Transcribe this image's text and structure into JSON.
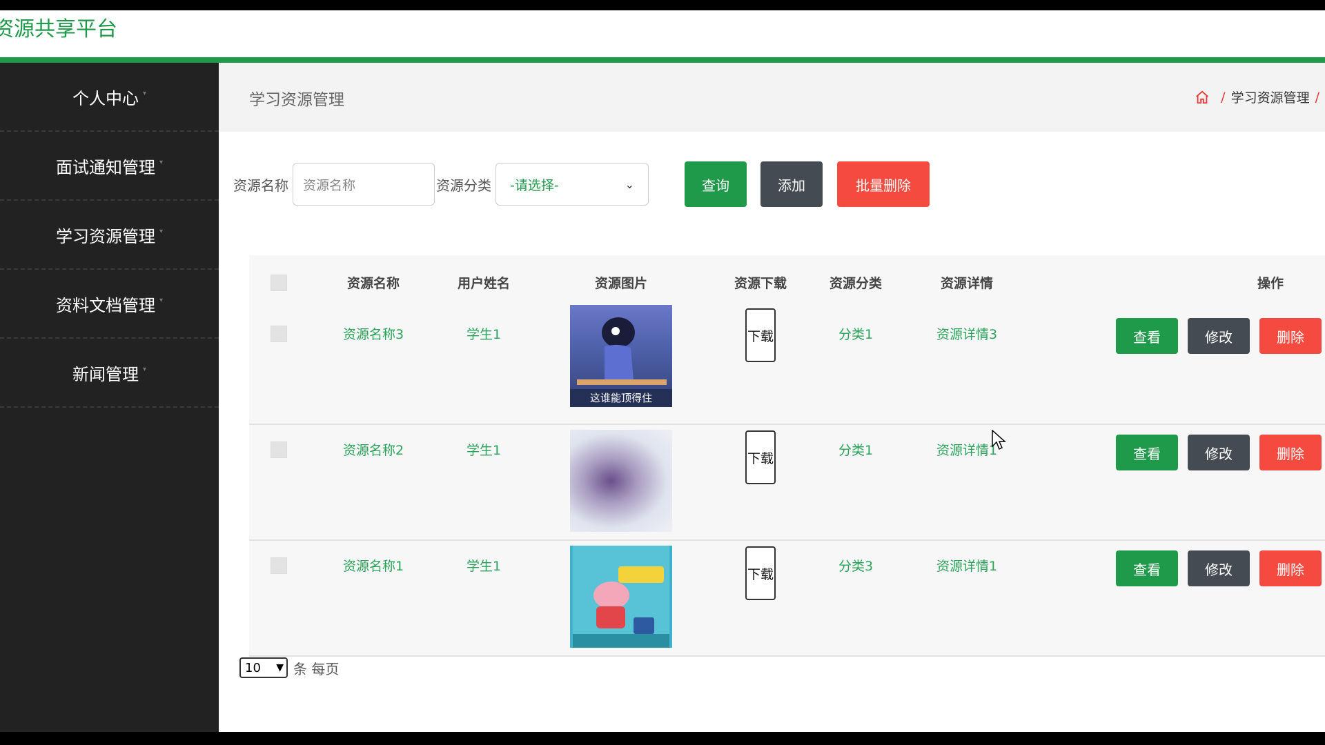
{
  "app": {
    "title": "资源共享平台",
    "accent": "#1f9a4a"
  },
  "sidebar": {
    "items": [
      {
        "label": "个人中心"
      },
      {
        "label": "面试通知管理"
      },
      {
        "label": "学习资源管理"
      },
      {
        "label": "资料文档管理"
      },
      {
        "label": "新闻管理"
      }
    ]
  },
  "header": {
    "title": "学习资源管理",
    "breadcrumb": [
      "学习资源管理"
    ],
    "home_icon": "home-icon"
  },
  "search": {
    "name_label": "资源名称",
    "name_placeholder": "资源名称",
    "category_label": "资源分类",
    "category_value": "-请选择-",
    "query_label": "查询",
    "add_label": "添加",
    "batch_delete_label": "批量删除"
  },
  "table": {
    "columns": [
      "资源名称",
      "用户姓名",
      "资源图片",
      "资源下载",
      "资源分类",
      "资源详情",
      "操作"
    ],
    "rows": [
      {
        "name": "资源名称3",
        "user": "学生1",
        "image_caption": "这谁能顶得住",
        "download": "下载",
        "category": "分类1",
        "detail": "资源详情3",
        "view": "查看",
        "edit": "修改",
        "delete": "删除"
      },
      {
        "name": "资源名称2",
        "user": "学生1",
        "image_caption": "",
        "download": "下载",
        "category": "分类1",
        "detail": "资源详情1",
        "view": "查看",
        "edit": "修改",
        "delete": "删除"
      },
      {
        "name": "资源名称1",
        "user": "学生1",
        "image_caption": "",
        "download": "下载",
        "category": "分类3",
        "detail": "资源详情1",
        "view": "查看",
        "edit": "修改",
        "delete": "删除"
      }
    ]
  },
  "pagination": {
    "page_size": "10",
    "suffix": "条 每页"
  }
}
